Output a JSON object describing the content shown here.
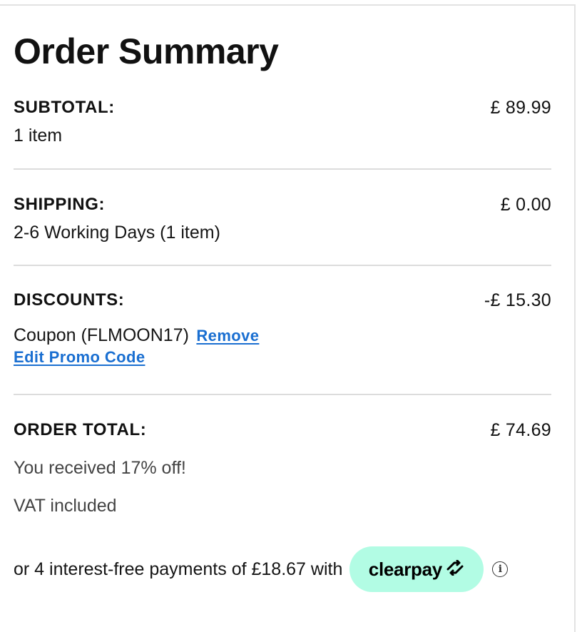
{
  "summary": {
    "title": "Order Summary"
  },
  "subtotal": {
    "label": "SUBTOTAL:",
    "amount": "£ 89.99",
    "detail": "1 item"
  },
  "shipping": {
    "label": "SHIPPING:",
    "amount": "£ 0.00",
    "detail": "2-6 Working Days (1 item)"
  },
  "discounts": {
    "label": "DISCOUNTS:",
    "amount": "-£ 15.30",
    "coupon_text": "Coupon (FLMOON17)",
    "remove_label": "Remove",
    "edit_promo_label": "Edit Promo Code"
  },
  "order_total": {
    "label": "ORDER TOTAL:",
    "amount": "£ 74.69",
    "savings_note": "You received 17% off!",
    "vat_note": "VAT included"
  },
  "installments": {
    "text": "or 4 interest-free payments of £18.67 with",
    "provider_logo": "clearpay",
    "provider_icon": "clearpay-arrows-icon",
    "badge_color": "#b2fce4",
    "info_icon": "info-icon",
    "info_glyph": "i"
  },
  "colors": {
    "link": "#1a6fd1",
    "divider": "#dcdcdc"
  }
}
